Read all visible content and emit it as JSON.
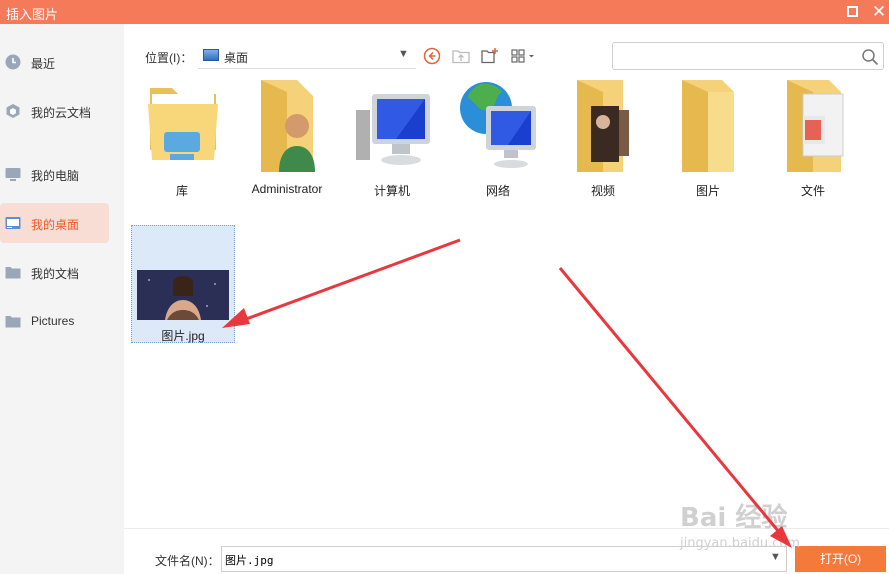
{
  "window": {
    "title": "插入图片"
  },
  "sidebar": {
    "items": [
      {
        "label": "最近",
        "icon": "clock-icon"
      },
      {
        "label": "我的云文档",
        "icon": "cloud-icon"
      },
      {
        "label": "我的电脑",
        "icon": "computer-icon"
      },
      {
        "label": "我的桌面",
        "icon": "desktop-icon",
        "active": true
      },
      {
        "label": "我的文档",
        "icon": "folder-icon"
      },
      {
        "label": "Pictures",
        "icon": "folder-icon"
      }
    ]
  },
  "toolbar": {
    "location_label": "位置(I)：",
    "location_value": "桌面",
    "search_placeholder": ""
  },
  "files": [
    {
      "name": "库",
      "icon": "library-folder-icon"
    },
    {
      "name": "Administrator",
      "icon": "user-folder-icon"
    },
    {
      "name": "计算机",
      "icon": "computer-icon"
    },
    {
      "name": "网络",
      "icon": "network-icon"
    },
    {
      "name": "视频",
      "icon": "video-folder-icon"
    },
    {
      "name": "图片",
      "icon": "picture-folder-icon"
    },
    {
      "name": "文件",
      "icon": "document-folder-icon"
    }
  ],
  "selected_file": {
    "name": "图片.jpg"
  },
  "bottom": {
    "filename_label": "文件名(N)：",
    "filename_value": "图片.jpg",
    "open_label": "打开(O)"
  },
  "watermark": {
    "main": "Bai 经验",
    "sub": "jingyan.baidu.com"
  },
  "colors": {
    "accent": "#f47a5a",
    "active_bg": "#f7ddd3",
    "open_button": "#f47a3c",
    "arrow": "#e8383d"
  }
}
